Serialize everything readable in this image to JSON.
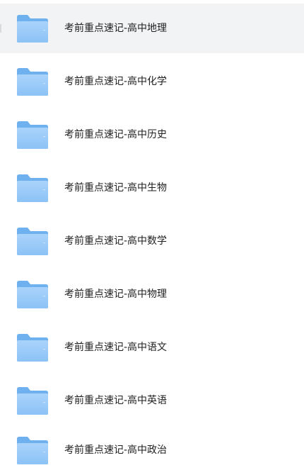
{
  "folders": [
    {
      "name": "考前重点速记-高中地理",
      "icon": "folder-icon",
      "selected": true
    },
    {
      "name": "考前重点速记-高中化学",
      "icon": "folder-icon",
      "selected": false
    },
    {
      "name": "考前重点速记-高中历史",
      "icon": "folder-icon",
      "selected": false
    },
    {
      "name": "考前重点速记-高中生物",
      "icon": "folder-icon",
      "selected": false
    },
    {
      "name": "考前重点速记-高中数学",
      "icon": "folder-icon",
      "selected": false
    },
    {
      "name": "考前重点速记-高中物理",
      "icon": "folder-icon",
      "selected": false
    },
    {
      "name": "考前重点速记-高中语文",
      "icon": "folder-icon",
      "selected": false
    },
    {
      "name": "考前重点速记-高中英语",
      "icon": "folder-icon",
      "selected": false
    },
    {
      "name": "考前重点速记-高中政治",
      "icon": "folder-icon",
      "selected": false
    }
  ],
  "colors": {
    "folder_back": "#6fb1ee",
    "folder_front_top": "#a9d3fb",
    "folder_front_bottom": "#8cc2f6",
    "selected_row_bg": "#f2f3f5",
    "text": "#1f1f1f"
  }
}
